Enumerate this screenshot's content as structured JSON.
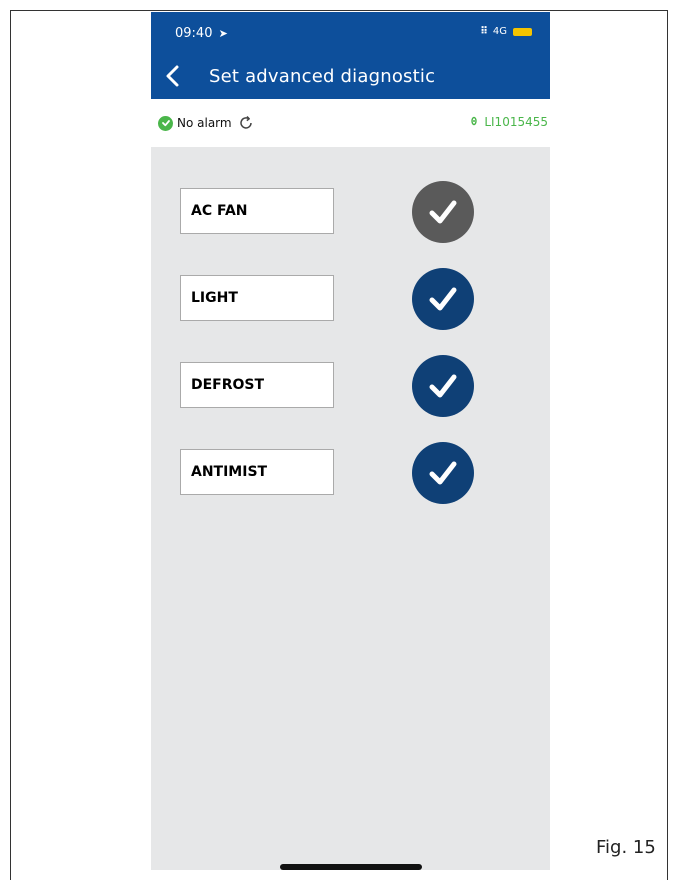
{
  "status_bar": {
    "time": "09:40",
    "network": "4G"
  },
  "header": {
    "title": "Set advanced diagnostic"
  },
  "alarm_bar": {
    "status": "No alarm",
    "device_id": "LI1015455"
  },
  "colors": {
    "header": "#0d4f9b",
    "check_active": "#0f4076",
    "check_inactive": "#5a5a5a",
    "ok_green": "#4ab64a"
  },
  "items": [
    {
      "label": "AC FAN",
      "checked": false
    },
    {
      "label": "LIGHT",
      "checked": true
    },
    {
      "label": "DEFROST",
      "checked": true
    },
    {
      "label": "ANTIMIST",
      "checked": true
    }
  ],
  "caption": "Fig. 15"
}
